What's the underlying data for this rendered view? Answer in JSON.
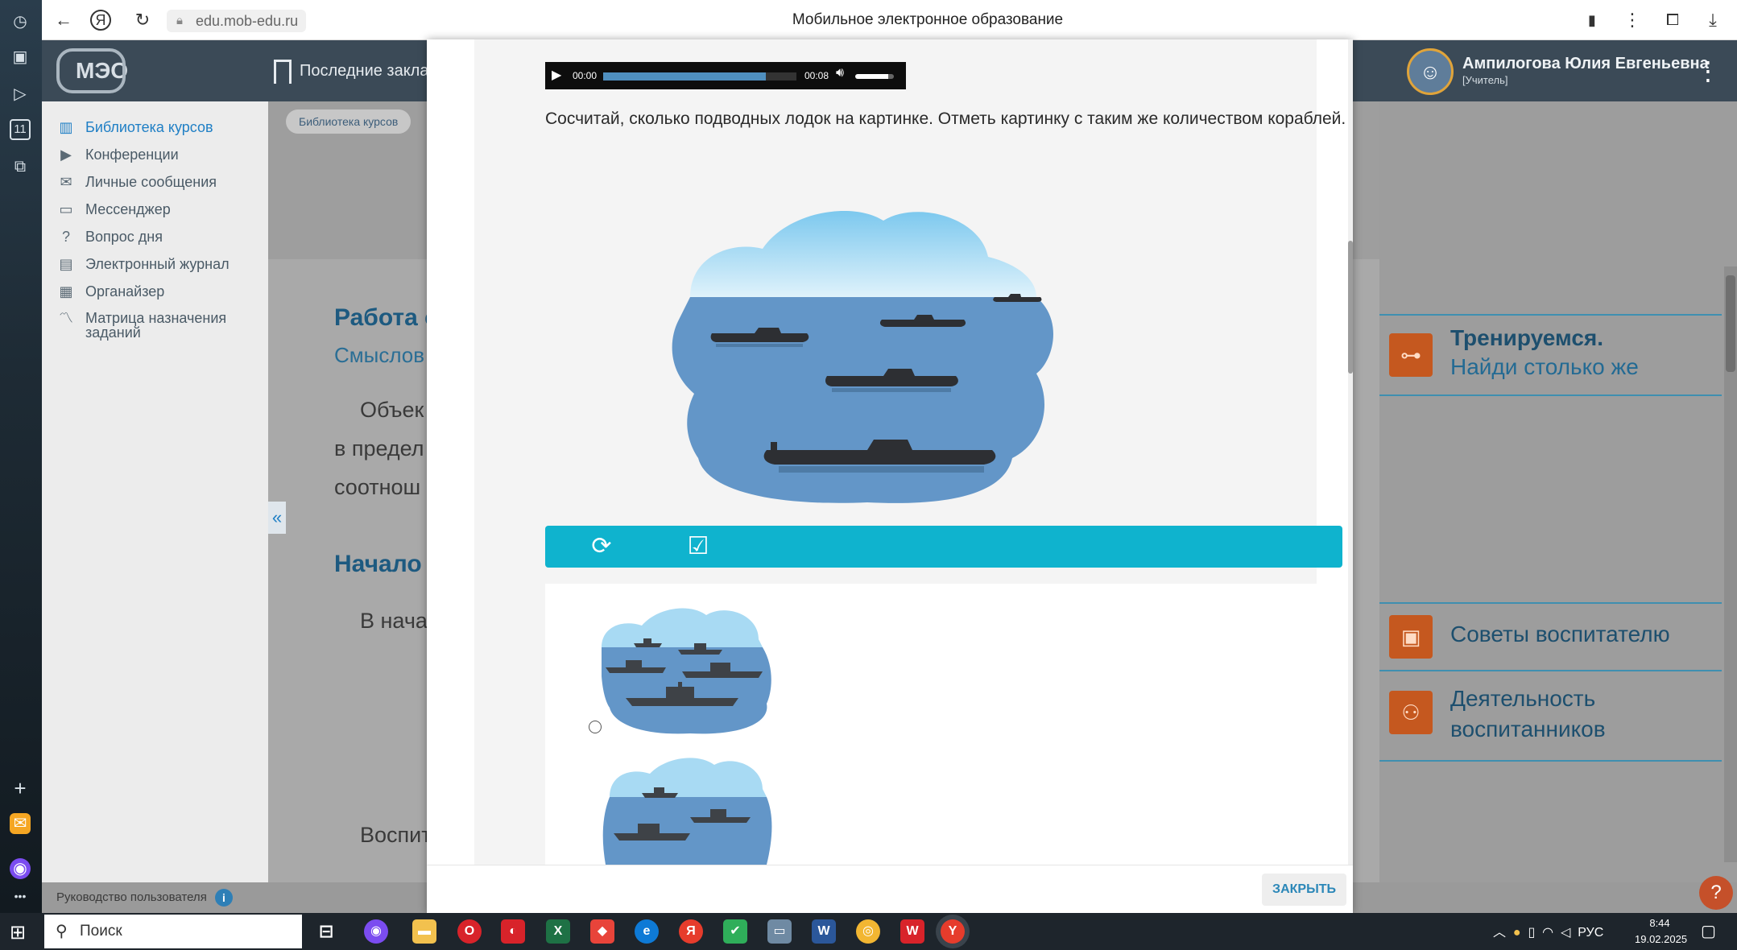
{
  "browser": {
    "url": "edu.mob-edu.ru",
    "page_title": "Мобильное электронное образование"
  },
  "site": {
    "logo_text": "МЭО",
    "bookmarks_label": "Последние закла",
    "user_name": "Ампилогова Юлия Евгеньевна",
    "user_role": "[Учитель]"
  },
  "sidebar": {
    "items": [
      {
        "label": "Библиотека курсов"
      },
      {
        "label": "Конференции"
      },
      {
        "label": "Личные сообщения"
      },
      {
        "label": "Мессенджер"
      },
      {
        "label": "Вопрос дня"
      },
      {
        "label": "Электронный журнал"
      },
      {
        "label": "Органайзер"
      },
      {
        "label": "Матрица назначения заданий"
      }
    ],
    "collapse": "«"
  },
  "main_bg": {
    "breadcrumb": "Библиотека курсов",
    "heading1": "Работа с",
    "subheading": "Смыслов",
    "line1": "Объек",
    "line2": "в предел",
    "line3": "соотнош",
    "heading2": "Начало",
    "line4": "В нача",
    "line5": "Воспит"
  },
  "right_panel": {
    "card1_title": "Тренируемся.",
    "card1_sub": "Найди столько же",
    "card2_title": "Советы воспитателю",
    "card3_line1": "Деятельность",
    "card3_line2": "воспитанников"
  },
  "footer": {
    "guide": "Руководство пользователя",
    "info": "i",
    "help": "?"
  },
  "modal": {
    "audio": {
      "current_time": "00:00",
      "duration": "00:08",
      "progress": 0.84,
      "volume": 0.85
    },
    "question": "Сосчитай, сколько подводных лодок на картинке. Отметь картинку с таким же количеством кораблей.",
    "close_label": "ЗАКРЫТЬ"
  },
  "taskbar": {
    "search_label": "Поиск",
    "lang": "РУС",
    "time": "8:44",
    "date": "19.02.2025"
  }
}
